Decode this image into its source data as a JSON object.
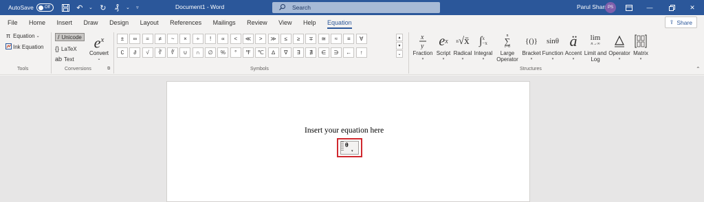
{
  "titlebar": {
    "autosave_label": "AutoSave",
    "autosave_state": "Off",
    "doc_title": "Document1 - Word",
    "search_placeholder": "Search",
    "user_name": "Parul Sharma",
    "avatar_initials": "PS"
  },
  "tabs": [
    "File",
    "Home",
    "Insert",
    "Draw",
    "Design",
    "Layout",
    "References",
    "Mailings",
    "Review",
    "View",
    "Help",
    "Equation"
  ],
  "active_tab": "Equation",
  "share_label": "Share",
  "ribbon": {
    "tools": {
      "equation_label": "Equation",
      "ink_equation_label": "Ink Equation",
      "group_label": "Tools"
    },
    "conversions": {
      "unicode_label": "Unicode",
      "latex_label": "LaTeX",
      "text_label": "Text",
      "convert_label": "Convert",
      "group_label": "Conversions"
    },
    "symbols": {
      "row1": [
        "±",
        "∞",
        "=",
        "≠",
        "~",
        "×",
        "÷",
        "!",
        "∝",
        "<",
        "≪",
        ">",
        "≫",
        "≤",
        "≥",
        "∓",
        "≅",
        "≈",
        "≡",
        "∀"
      ],
      "row2": [
        "∁",
        "∂",
        "√",
        "∛",
        "∜",
        "∪",
        "∩",
        "∅",
        "%",
        "°",
        "℉",
        "℃",
        "∆",
        "∇",
        "∃",
        "∄",
        "∈",
        "∋",
        "←",
        "↑"
      ],
      "group_label": "Symbols"
    },
    "structures": {
      "items": [
        {
          "label": "Fraction",
          "glyph": "x/y"
        },
        {
          "label": "Script",
          "glyph": "eˣ"
        },
        {
          "label": "Radical",
          "glyph": "ⁿ√x"
        },
        {
          "label": "Integral",
          "glyph": "∫ˣ₋ₓ"
        },
        {
          "label": "Large Operator",
          "glyph": "∑"
        },
        {
          "label": "Bracket",
          "glyph": "{()}"
        },
        {
          "label": "Function",
          "glyph": "sinθ"
        },
        {
          "label": "Accent",
          "glyph": "ä"
        },
        {
          "label": "Limit and Log",
          "glyph": "lim"
        },
        {
          "label": "Operator",
          "glyph": "Δ"
        },
        {
          "label": "Matrix",
          "glyph": "[10 01]"
        }
      ],
      "group_label": "Structures"
    }
  },
  "document": {
    "equation_prompt": "Insert your equation here",
    "equation_content": "θ"
  },
  "colors": {
    "titlebar": "#2b579a",
    "highlight_border": "#d0282e"
  }
}
